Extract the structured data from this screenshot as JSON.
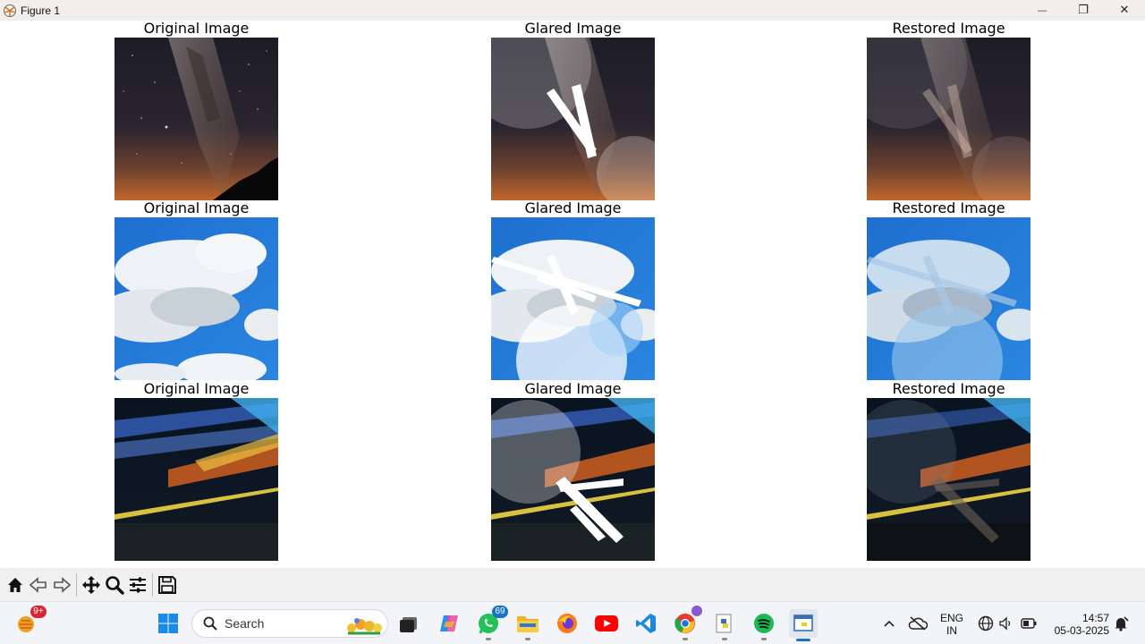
{
  "window": {
    "title": "Figure 1",
    "controls": {
      "minimize": "—",
      "maximize": "❐",
      "close": "✕"
    }
  },
  "figure": {
    "rows": [
      {
        "scene": "milky-way-night-sky",
        "titles": [
          "Original Image",
          "Glared Image",
          "Restored Image"
        ]
      },
      {
        "scene": "blue-sky-clouds",
        "titles": [
          "Original Image",
          "Glared Image",
          "Restored Image"
        ]
      },
      {
        "scene": "light-trails-road",
        "titles": [
          "Original Image",
          "Glared Image",
          "Restored Image"
        ]
      }
    ]
  },
  "toolbar": {
    "items": [
      "home-icon",
      "back-arrow-icon",
      "forward-arrow-icon",
      "pan-move-icon",
      "zoom-magnifier-icon",
      "configure-subplots-icon",
      "save-figure-icon"
    ]
  },
  "taskbar": {
    "weather_badge": "9+",
    "search_label": "Search",
    "whatsapp_badge": "69",
    "tray": {
      "language_top": "ENG",
      "language_bottom": "IN",
      "time": "14:57",
      "date": "05-03-2025"
    }
  },
  "colors": {
    "titlebar_bg": "#f2eeee",
    "toolbar_bg": "#f0f0f0",
    "taskbar_bg": "#f3f4f7",
    "accent": "#1a6fd6"
  }
}
